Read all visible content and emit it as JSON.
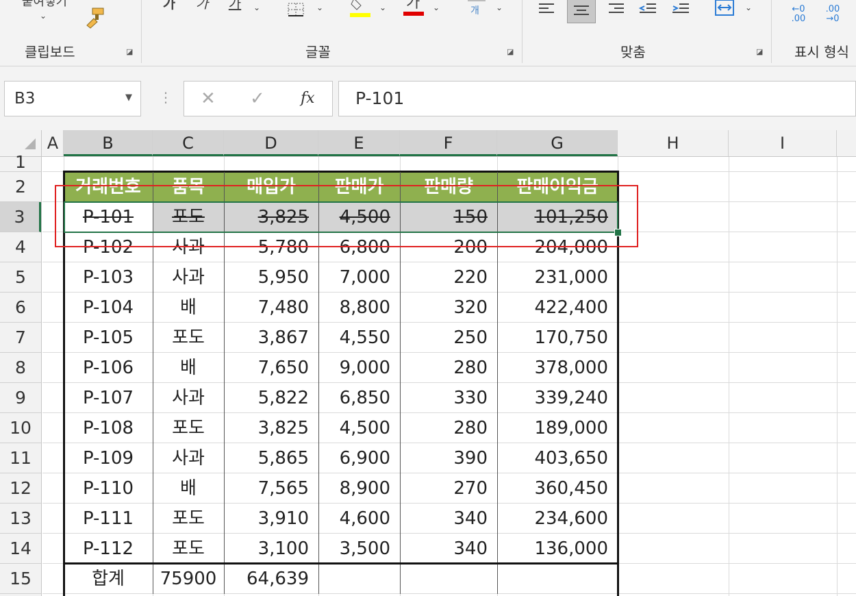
{
  "ribbon": {
    "groups": [
      {
        "label": "클립보드"
      },
      {
        "label": "글꼴"
      },
      {
        "label": "맞춤"
      },
      {
        "label": "표시 형식"
      }
    ],
    "paste_label": "붙여넣기",
    "font_bold": "가",
    "font_italic": "가",
    "font_underline": "가",
    "font_color_glyph": "가",
    "fill_color": "#ffff00",
    "font_color": "#e00000",
    "inc_decimal": "←0 .00",
    "dec_decimal": ".00 →0"
  },
  "formula_bar": {
    "name_box": "B3",
    "formula": "P-101",
    "fx": "fx",
    "cancel": "✕",
    "enter": "✓"
  },
  "columns": [
    "A",
    "B",
    "C",
    "D",
    "E",
    "F",
    "G",
    "H",
    "I"
  ],
  "rows": [
    "1",
    "2",
    "3",
    "4",
    "5",
    "6",
    "7",
    "8",
    "9",
    "10",
    "11",
    "12",
    "13",
    "14",
    "15"
  ],
  "table": {
    "headers": [
      "거래번호",
      "품목",
      "매입가",
      "판매가",
      "판매량",
      "판매이익금"
    ],
    "rows": [
      [
        "P-101",
        "포도",
        "3,825",
        "4,500",
        "150",
        "101,250"
      ],
      [
        "P-102",
        "사과",
        "5,780",
        "6,800",
        "200",
        "204,000"
      ],
      [
        "P-103",
        "사과",
        "5,950",
        "7,000",
        "220",
        "231,000"
      ],
      [
        "P-104",
        "배",
        "7,480",
        "8,800",
        "320",
        "422,400"
      ],
      [
        "P-105",
        "포도",
        "3,867",
        "4,550",
        "250",
        "170,750"
      ],
      [
        "P-106",
        "배",
        "7,650",
        "9,000",
        "280",
        "378,000"
      ],
      [
        "P-107",
        "사과",
        "5,822",
        "6,850",
        "330",
        "339,240"
      ],
      [
        "P-108",
        "포도",
        "3,825",
        "4,500",
        "280",
        "189,000"
      ],
      [
        "P-109",
        "사과",
        "5,865",
        "6,900",
        "390",
        "403,650"
      ],
      [
        "P-110",
        "배",
        "7,565",
        "8,900",
        "270",
        "360,450"
      ],
      [
        "P-111",
        "포도",
        "3,910",
        "4,600",
        "340",
        "234,600"
      ],
      [
        "P-112",
        "포도",
        "3,100",
        "3,500",
        "340",
        "136,000"
      ]
    ],
    "total": [
      "합계",
      "75900",
      "64,639",
      "",
      "",
      ""
    ]
  },
  "colors": {
    "header_fill": "#8fb04f",
    "selection": "#217346",
    "highlight_box": "#e02020"
  }
}
